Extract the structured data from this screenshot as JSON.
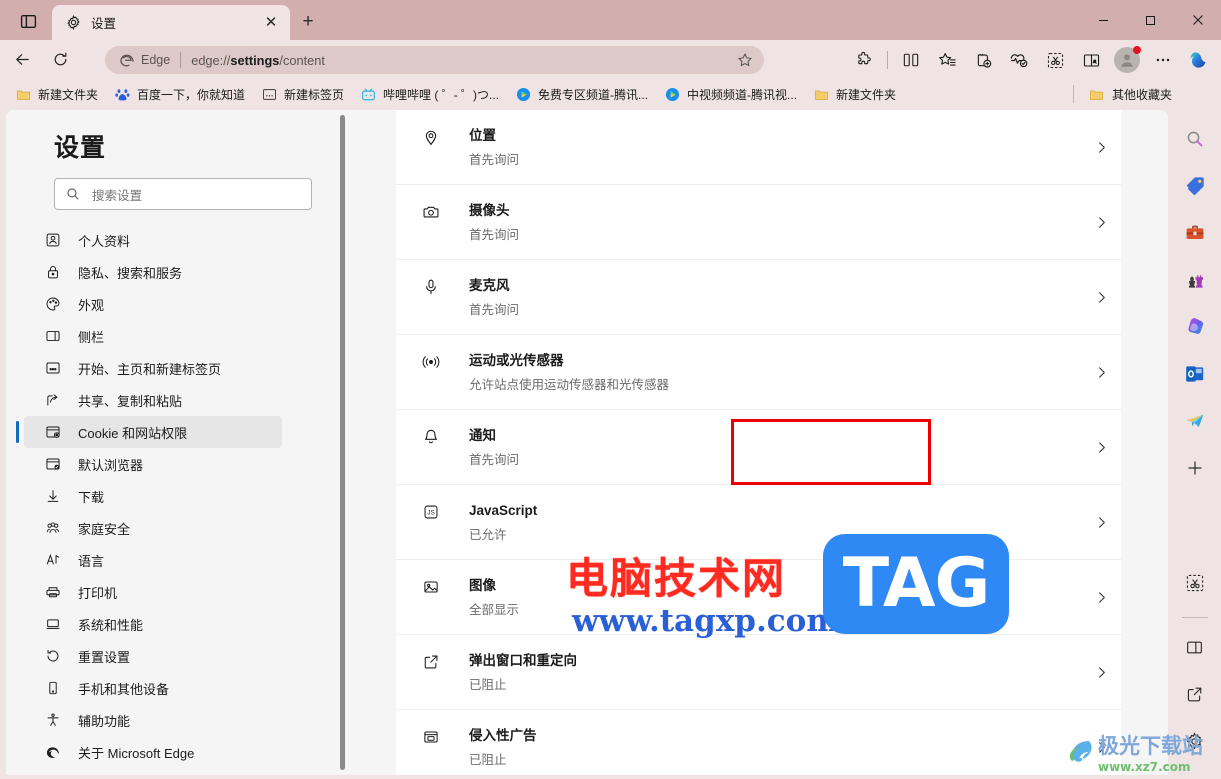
{
  "window": {
    "controls": {
      "minimize": "—",
      "maximize": "▢",
      "close": "✕"
    }
  },
  "tabbar": {
    "tab_list_icon": "tab-list-icon",
    "tab": {
      "title": "设置",
      "favicon": "gear-icon",
      "close": "✕"
    },
    "new_tab": "+"
  },
  "navbar": {
    "back": "←",
    "refresh": "⟳",
    "omnibox": {
      "badge": "Edge",
      "url_prefix": "edge://",
      "url_bold": "settings",
      "url_suffix": "/content",
      "url_full": "edge://settings/content",
      "favorite_icon": "star-icon"
    },
    "buttons": [
      {
        "name": "extensions-button",
        "icon": "puzzle-icon"
      },
      {
        "name": "split-screen-button",
        "icon": "split-screen-icon"
      },
      {
        "name": "favorites-button",
        "icon": "favorites-star-icon"
      },
      {
        "name": "collections-button",
        "icon": "collections-add-icon"
      },
      {
        "name": "browser-essentials-button",
        "icon": "heart-pulse-icon"
      },
      {
        "name": "screenshot-button",
        "icon": "scissors-icon"
      },
      {
        "name": "read-aloud-button",
        "icon": "read-aloud-icon"
      },
      {
        "name": "profile-button",
        "icon": "avatar-icon"
      },
      {
        "name": "settings-more-button",
        "icon": "ellipsis-icon"
      },
      {
        "name": "copilot-button",
        "icon": "copilot-icon"
      }
    ]
  },
  "bookmarks": {
    "items": [
      {
        "label": "新建文件夹",
        "icon": "folder-icon"
      },
      {
        "label": "百度一下，你就知道",
        "icon": "baidu-icon"
      },
      {
        "label": "新建标签页",
        "icon": "newtab-icon"
      },
      {
        "label": "哔哩哔哩 ( ゜- ゜)つ...",
        "icon": "bilibili-icon"
      },
      {
        "label": "免费专区频道-腾讯...",
        "icon": "tencent-video-icon"
      },
      {
        "label": "中视频频道-腾讯视...",
        "icon": "tencent-video-icon"
      },
      {
        "label": "新建文件夹",
        "icon": "folder-icon"
      }
    ],
    "other": {
      "label": "其他收藏夹",
      "icon": "folder-icon"
    }
  },
  "settings": {
    "title": "设置",
    "search_placeholder": "搜索设置",
    "search_value": "",
    "nav": [
      {
        "label": "个人资料",
        "icon": "profile-icon",
        "active": false
      },
      {
        "label": "隐私、搜索和服务",
        "icon": "lock-icon",
        "active": false
      },
      {
        "label": "外观",
        "icon": "palette-icon",
        "active": false
      },
      {
        "label": "侧栏",
        "icon": "sidebar-icon",
        "active": false
      },
      {
        "label": "开始、主页和新建标签页",
        "icon": "newtab-page-icon",
        "active": false
      },
      {
        "label": "共享、复制和粘贴",
        "icon": "share-icon",
        "active": false
      },
      {
        "label": "Cookie 和网站权限",
        "icon": "cookie-permissions-icon",
        "active": true
      },
      {
        "label": "默认浏览器",
        "icon": "default-browser-icon",
        "active": false
      },
      {
        "label": "下载",
        "icon": "download-icon",
        "active": false
      },
      {
        "label": "家庭安全",
        "icon": "family-icon",
        "active": false
      },
      {
        "label": "语言",
        "icon": "language-icon",
        "active": false
      },
      {
        "label": "打印机",
        "icon": "printer-icon",
        "active": false
      },
      {
        "label": "系统和性能",
        "icon": "system-icon",
        "active": false
      },
      {
        "label": "重置设置",
        "icon": "reset-icon",
        "active": false
      },
      {
        "label": "手机和其他设备",
        "icon": "phone-icon",
        "active": false
      },
      {
        "label": "辅助功能",
        "icon": "accessibility-icon",
        "active": false
      },
      {
        "label": "关于 Microsoft Edge",
        "icon": "edge-logo-icon",
        "active": false
      }
    ]
  },
  "permissions": {
    "rows": [
      {
        "title": "位置",
        "subtitle": "首先询问",
        "icon": "location-icon",
        "highlighted": false
      },
      {
        "title": "摄像头",
        "subtitle": "首先询问",
        "icon": "camera-icon",
        "highlighted": false
      },
      {
        "title": "麦克风",
        "subtitle": "首先询问",
        "icon": "microphone-icon",
        "highlighted": false
      },
      {
        "title": "运动或光传感器",
        "subtitle": "允许站点使用运动传感器和光传感器",
        "icon": "sensor-icon",
        "highlighted": false
      },
      {
        "title": "通知",
        "subtitle": "首先询问",
        "icon": "bell-icon",
        "highlighted": true
      },
      {
        "title": "JavaScript",
        "subtitle": "已允许",
        "icon": "javascript-icon",
        "highlighted": false
      },
      {
        "title": "图像",
        "subtitle": "全部显示",
        "icon": "image-icon",
        "highlighted": false
      },
      {
        "title": "弹出窗口和重定向",
        "subtitle": "已阻止",
        "icon": "popup-icon",
        "highlighted": false
      },
      {
        "title": "侵入性广告",
        "subtitle": "已阻止",
        "icon": "ads-icon",
        "highlighted": false
      }
    ],
    "chevron": "›"
  },
  "edgebar": {
    "top": [
      {
        "name": "sidebar-search-icon",
        "icon": "search-icon"
      },
      {
        "name": "sidebar-shopping-icon",
        "icon": "tag-icon"
      },
      {
        "name": "sidebar-tools-icon",
        "icon": "toolbox-icon"
      },
      {
        "name": "sidebar-games-icon",
        "icon": "chess-icon"
      },
      {
        "name": "sidebar-office-icon",
        "icon": "microsoft365-icon"
      },
      {
        "name": "sidebar-outlook-icon",
        "icon": "outlook-icon"
      },
      {
        "name": "sidebar-telegram-icon",
        "icon": "paper-plane-icon"
      },
      {
        "name": "sidebar-add-icon",
        "icon": "plus-icon"
      }
    ],
    "bottom": [
      {
        "name": "sidebar-screenshot-icon",
        "icon": "scissors-icon"
      },
      {
        "name": "sidebar-split-icon",
        "icon": "split-pane-icon"
      },
      {
        "name": "sidebar-open-icon",
        "icon": "open-external-icon"
      },
      {
        "name": "sidebar-settings-icon",
        "icon": "gear-icon"
      }
    ]
  },
  "watermarks": {
    "line1": "电脑技术网",
    "line2": "www.tagxp.com",
    "tag": "TAG",
    "corner_cn": "极光下载站",
    "corner_url": "www.xz7.com"
  },
  "colors": {
    "titlebar": "#d3aeae",
    "chrome": "#efe4e3",
    "accent": "#0f6cbd",
    "highlight": "#ee0000",
    "page": "#f5f5f5",
    "card": "#ffffff"
  }
}
